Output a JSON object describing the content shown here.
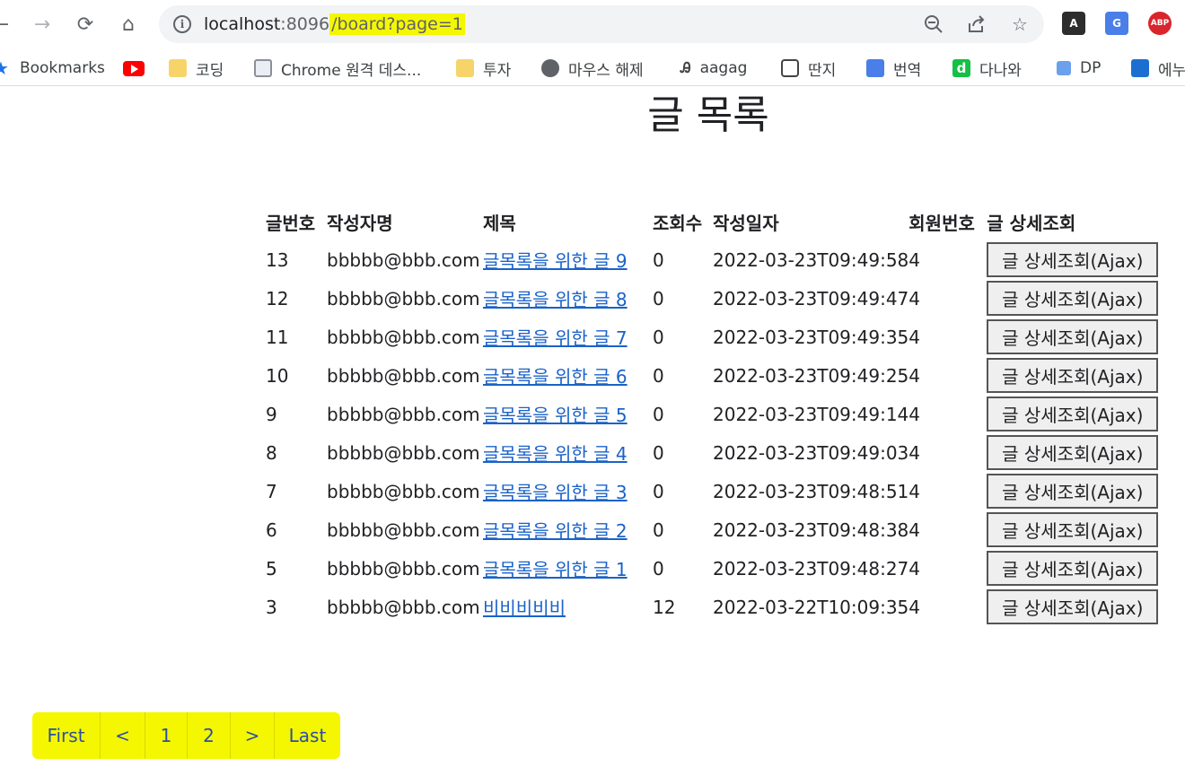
{
  "browser": {
    "url": {
      "host": "localhost",
      "port": ":8096",
      "path": "/board?page=1"
    },
    "bookmarks": [
      {
        "label": "Bookmarks",
        "icon": "star-icon"
      },
      {
        "label": "",
        "icon": "youtube-icon"
      },
      {
        "label": "코딩",
        "icon": "folder-icon"
      },
      {
        "label": "Chrome 원격 데스...",
        "icon": "remote-desktop-icon"
      },
      {
        "label": "투자",
        "icon": "folder-icon"
      },
      {
        "label": "마우스 해제",
        "icon": "globe-icon"
      },
      {
        "label": "aagag",
        "icon": "aagag-icon"
      },
      {
        "label": "딴지",
        "icon": "ddanzi-icon"
      },
      {
        "label": "번역",
        "icon": "translate-icon"
      },
      {
        "label": "다나와",
        "icon": "danawa-icon"
      },
      {
        "label": "DP",
        "icon": "dp-icon"
      },
      {
        "label": "에누",
        "icon": "enuri-icon"
      }
    ],
    "extensions": [
      "A",
      "G",
      "ABP"
    ]
  },
  "page": {
    "title": "글 목록",
    "columns": [
      "글번호",
      "작성자명",
      "제목",
      "조회수",
      "작성일자",
      "회원번호",
      "글 상세조회"
    ],
    "rows": [
      {
        "no": "13",
        "author": "bbbbb@bbb.com",
        "title": "글목록을 위한 글 9",
        "views": "0",
        "date": "2022-03-23T09:49:58",
        "member": "4",
        "button": "글 상세조회(Ajax)"
      },
      {
        "no": "12",
        "author": "bbbbb@bbb.com",
        "title": "글목록을 위한 글 8",
        "views": "0",
        "date": "2022-03-23T09:49:47",
        "member": "4",
        "button": "글 상세조회(Ajax)"
      },
      {
        "no": "11",
        "author": "bbbbb@bbb.com",
        "title": "글목록을 위한 글 7",
        "views": "0",
        "date": "2022-03-23T09:49:35",
        "member": "4",
        "button": "글 상세조회(Ajax)"
      },
      {
        "no": "10",
        "author": "bbbbb@bbb.com",
        "title": "글목록을 위한 글 6",
        "views": "0",
        "date": "2022-03-23T09:49:25",
        "member": "4",
        "button": "글 상세조회(Ajax)"
      },
      {
        "no": "9",
        "author": "bbbbb@bbb.com",
        "title": "글목록을 위한 글 5",
        "views": "0",
        "date": "2022-03-23T09:49:14",
        "member": "4",
        "button": "글 상세조회(Ajax)"
      },
      {
        "no": "8",
        "author": "bbbbb@bbb.com",
        "title": "글목록을 위한 글 4",
        "views": "0",
        "date": "2022-03-23T09:49:03",
        "member": "4",
        "button": "글 상세조회(Ajax)"
      },
      {
        "no": "7",
        "author": "bbbbb@bbb.com",
        "title": "글목록을 위한 글 3",
        "views": "0",
        "date": "2022-03-23T09:48:51",
        "member": "4",
        "button": "글 상세조회(Ajax)"
      },
      {
        "no": "6",
        "author": "bbbbb@bbb.com",
        "title": "글목록을 위한 글 2",
        "views": "0",
        "date": "2022-03-23T09:48:38",
        "member": "4",
        "button": "글 상세조회(Ajax)"
      },
      {
        "no": "5",
        "author": "bbbbb@bbb.com",
        "title": "글목록을 위한 글 1",
        "views": "0",
        "date": "2022-03-23T09:48:27",
        "member": "4",
        "button": "글 상세조회(Ajax)"
      },
      {
        "no": "3",
        "author": "bbbbb@bbb.com",
        "title": "비비비비비",
        "views": "12",
        "date": "2022-03-22T10:09:35",
        "member": "4",
        "button": "글 상세조회(Ajax)"
      }
    ],
    "pagination": [
      "First",
      "<",
      "1",
      "2",
      ">",
      "Last"
    ]
  },
  "colors": {
    "highlight": "#f5f700",
    "link": "#1a62c8",
    "pager_text": "#2b4fa3"
  }
}
